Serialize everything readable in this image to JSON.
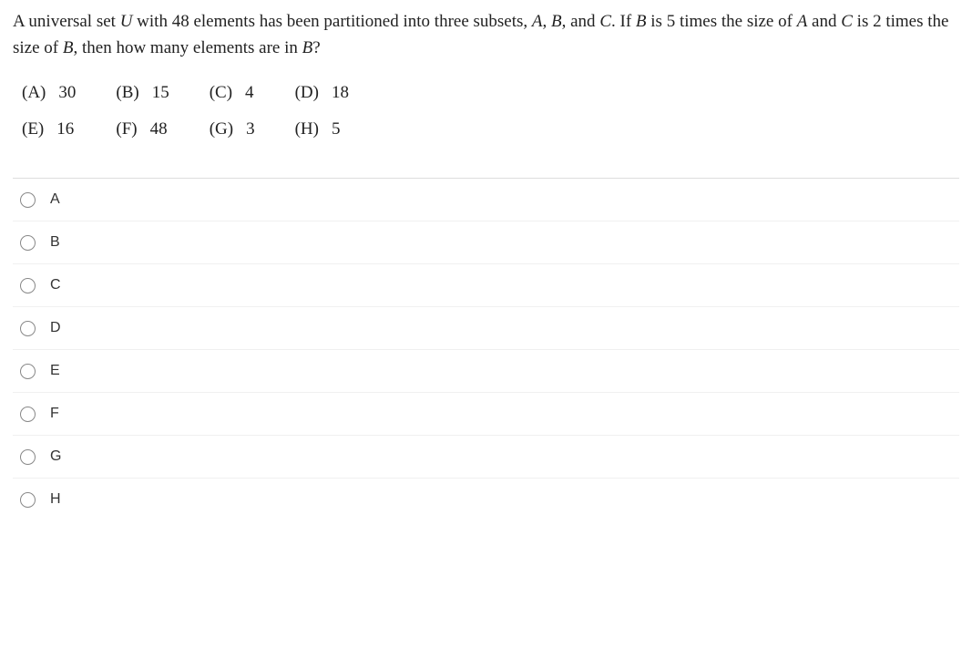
{
  "question": {
    "part1": "A universal set ",
    "u": "U",
    "part2": " with 48 elements has been partitioned into three subsets, ",
    "a": "A",
    "comma1": ", ",
    "b": "B",
    "part3": ", and ",
    "c": "C",
    "part4": ". If ",
    "b2": "B",
    "part5": " is 5 times the size of ",
    "a2": "A",
    "part6": " and ",
    "c2": "C",
    "part7": " is 2 times the size of ",
    "b3": "B",
    "part8": ", then how many elements are in ",
    "b4": "B",
    "part9": "?"
  },
  "choices": [
    {
      "letter": "(A)",
      "value": "30"
    },
    {
      "letter": "(B)",
      "value": "15"
    },
    {
      "letter": "(C)",
      "value": "4"
    },
    {
      "letter": "(D)",
      "value": "18"
    },
    {
      "letter": "(E)",
      "value": "16"
    },
    {
      "letter": "(F)",
      "value": "48"
    },
    {
      "letter": "(G)",
      "value": "3"
    },
    {
      "letter": "(H)",
      "value": "5"
    }
  ],
  "radios": [
    "A",
    "B",
    "C",
    "D",
    "E",
    "F",
    "G",
    "H"
  ]
}
